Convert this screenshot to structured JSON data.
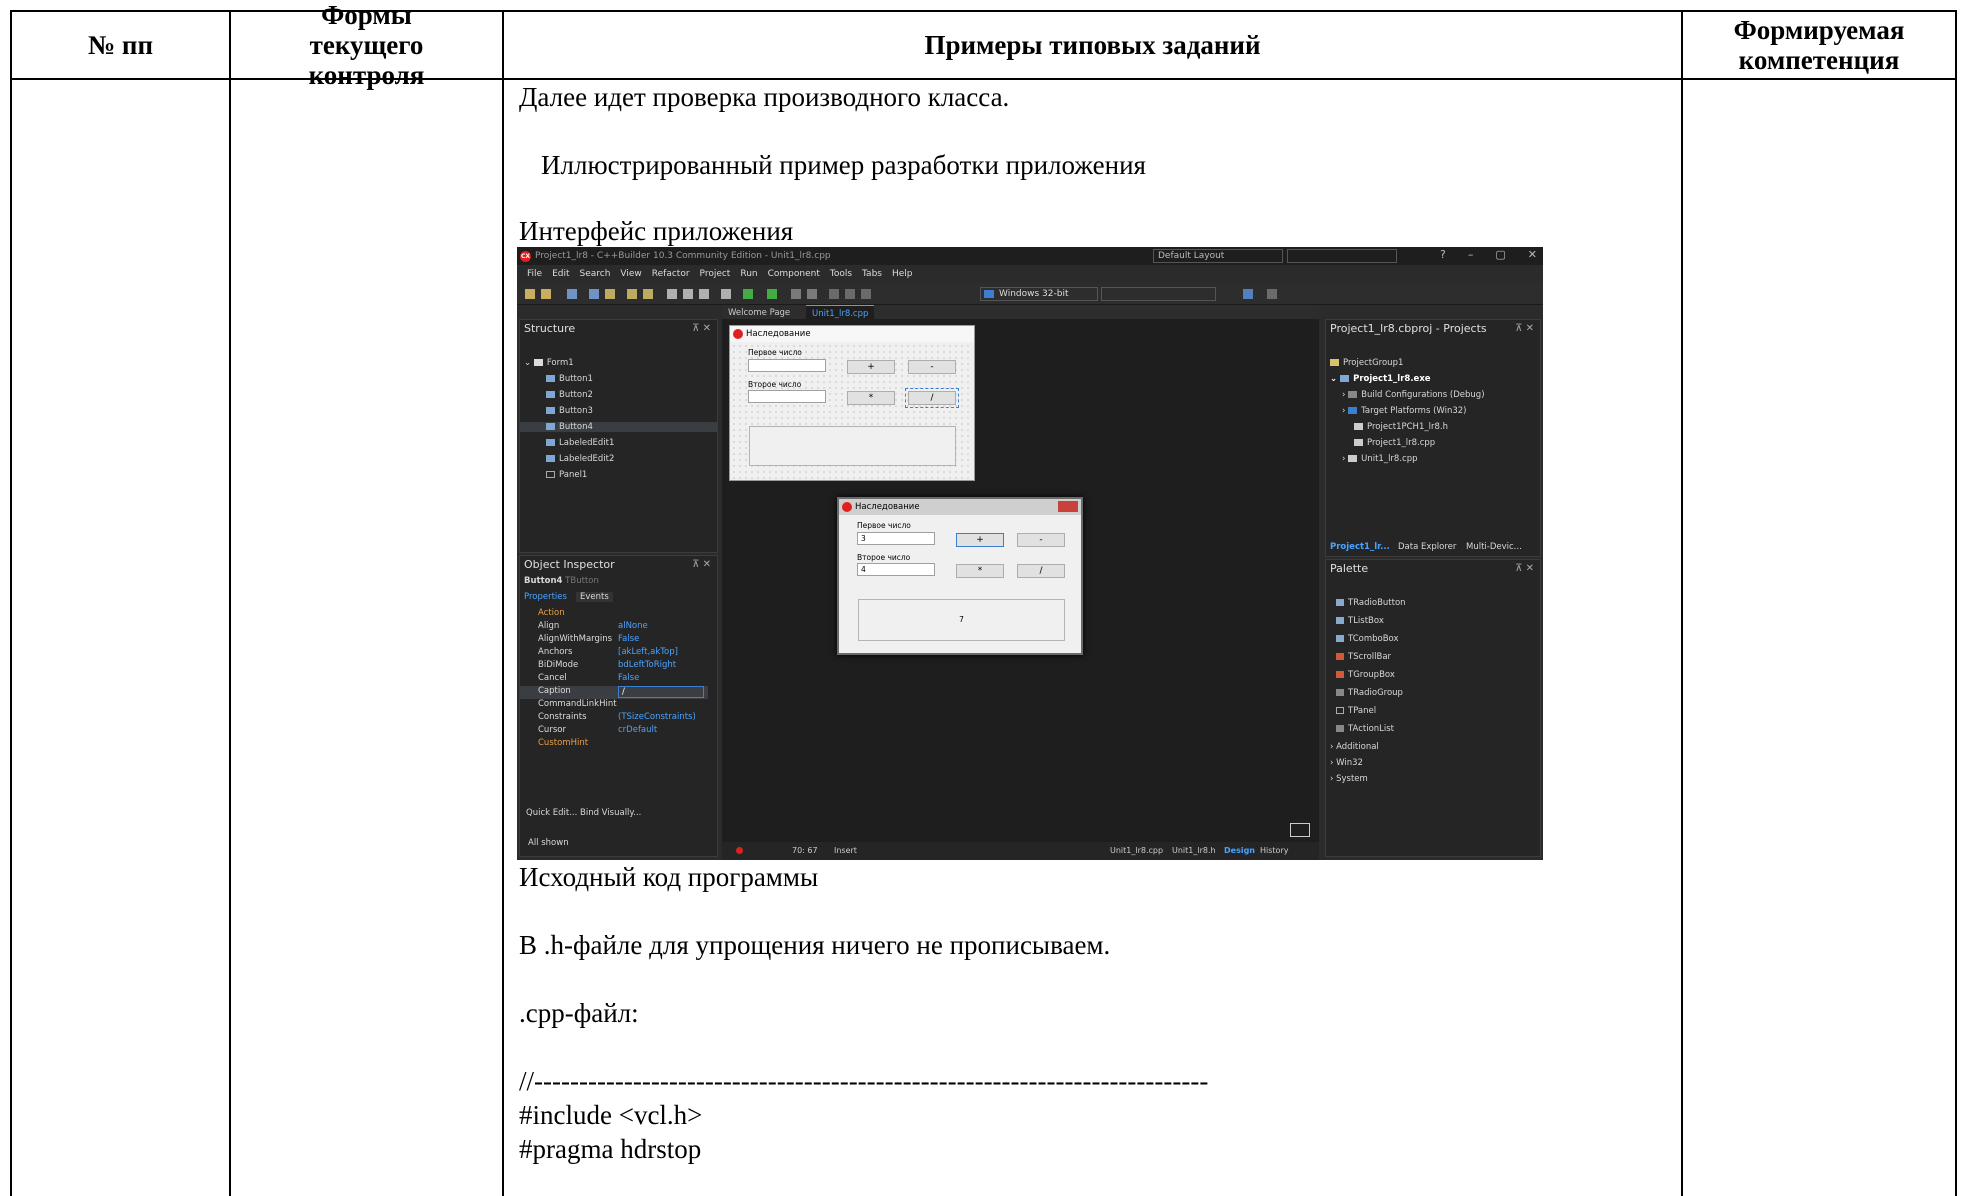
{
  "table": {
    "headers": {
      "col1": "№ пп",
      "col2": "Формы текущего контроля",
      "col3": "Примеры типовых заданий",
      "col4": "Формируемая компетенция"
    },
    "lines": {
      "line1": "Далее идет проверка производного класса.",
      "line2": "Иллюстрированный пример разработки приложения",
      "line3": "Интерфейс приложения",
      "line4": "Исходный код программы",
      "line5": "В .h-файле для упрощения ничего не прописываем.",
      "line6": ".cpp-файл:",
      "line7": "//---------------------------------------------------------------------------",
      "line8": "#include <vcl.h>",
      "line9": "#pragma hdrstop"
    }
  },
  "ide": {
    "title": "Project1_lr8 - C++Builder 10.3 Community Edition - Unit1_lr8.cpp",
    "logo": "CX",
    "layout": "Default Layout",
    "help": "?",
    "menu": [
      "File",
      "Edit",
      "Search",
      "View",
      "Refactor",
      "Project",
      "Run",
      "Component",
      "Tools",
      "Tabs",
      "Help"
    ],
    "platform": "Windows 32-bit",
    "structure": {
      "title": "Structure",
      "items": [
        "Form1",
        "Button1",
        "Button2",
        "Button3",
        "Button4",
        "LabeledEdit1",
        "LabeledEdit2",
        "Panel1"
      ]
    },
    "inspector": {
      "title": "Object Inspector",
      "object": "Button4",
      "object_type": "TButton",
      "tab_properties": "Properties",
      "tab_events": "Events",
      "rows": [
        {
          "k": "Action",
          "v": ""
        },
        {
          "k": "Align",
          "v": "alNone"
        },
        {
          "k": "AlignWithMargins",
          "v": "False"
        },
        {
          "k": "Anchors",
          "v": "[akLeft,akTop]"
        },
        {
          "k": "BiDiMode",
          "v": "bdLeftToRight"
        },
        {
          "k": "Cancel",
          "v": "False"
        },
        {
          "k": "Caption",
          "v": "/"
        },
        {
          "k": "CommandLinkHint",
          "v": ""
        },
        {
          "k": "Constraints",
          "v": "(TSizeConstraints)"
        },
        {
          "k": "Cursor",
          "v": "crDefault"
        },
        {
          "k": "CustomHint",
          "v": ""
        }
      ],
      "footer_links": "Quick Edit...  Bind Visually...",
      "shown": "All shown"
    },
    "tabs": {
      "welcome": "Welcome Page",
      "unit": "Unit1_lr8.cpp"
    },
    "design_form": {
      "title": "Наследование",
      "label1": "Первое число",
      "label2": "Второе число",
      "btn_plus": "+",
      "btn_minus": "-",
      "btn_mul": "*",
      "btn_div": "/"
    },
    "run_form": {
      "title": "Наследование",
      "label1": "Первое число",
      "label2": "Второе число",
      "value1": "3",
      "value2": "4",
      "btn_plus": "+",
      "btn_minus": "-",
      "btn_mul": "*",
      "btn_div": "/",
      "result": "7"
    },
    "status": {
      "position": "70: 67",
      "mode": "Insert",
      "file_cpp": "Unit1_lr8.cpp",
      "file_h": "Unit1_lr8.h",
      "design": "Design",
      "history": "History"
    },
    "projects": {
      "title": "Project1_lr8.cbproj - Projects",
      "items": [
        "ProjectGroup1",
        "Project1_lr8.exe",
        "Build Configurations (Debug)",
        "Target Platforms (Win32)",
        "Project1PCH1_lr8.h",
        "Project1_lr8.cpp",
        "Unit1_lr8.cpp"
      ],
      "tabs": [
        "Project1_lr...",
        "Data Explorer",
        "Multi-Devic..."
      ]
    },
    "palette": {
      "title": "Palette",
      "items": [
        "TRadioButton",
        "TListBox",
        "TComboBox",
        "TScrollBar",
        "TGroupBox",
        "TRadioGroup",
        "TPanel",
        "TActionList",
        "Additional",
        "Win32",
        "System"
      ]
    }
  }
}
